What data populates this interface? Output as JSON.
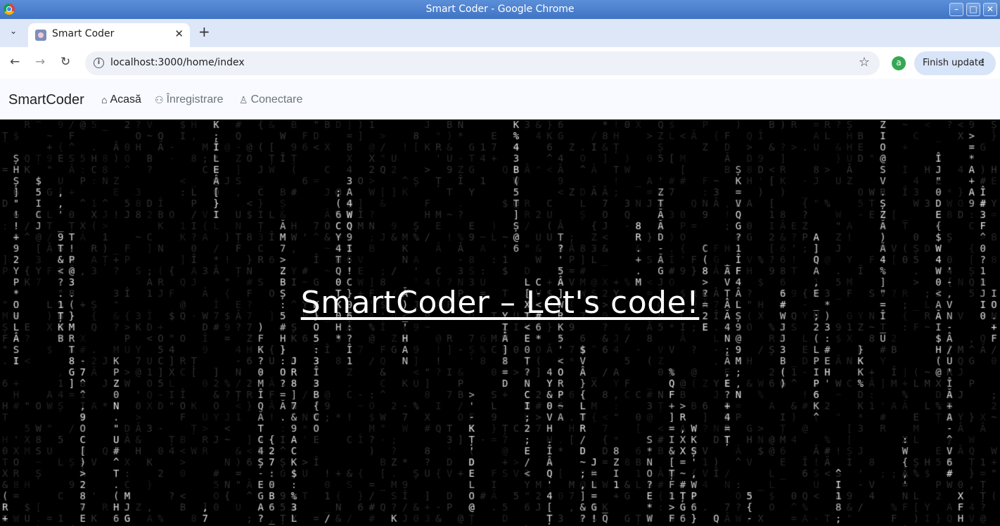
{
  "window": {
    "title": "Smart Coder - Google Chrome",
    "controls": {
      "minimize": "–",
      "maximize": "□",
      "close": "✕"
    }
  },
  "browser": {
    "tab_list_icon": "⌄",
    "tab": {
      "title": "Smart Coder",
      "close": "✕"
    },
    "new_tab": "+",
    "back": "←",
    "forward": "→",
    "reload": "↻",
    "site_info": "i",
    "url": "localhost:3000/home/index",
    "bookmark": "☆",
    "profile_initial": "a",
    "update_button": "Finish update",
    "menu": "⋮"
  },
  "site": {
    "brand": "SmartCoder",
    "nav": [
      {
        "label": "Acasă",
        "icon": "home-icon",
        "glyph": "⌂"
      },
      {
        "label": "Înregistrare",
        "icon": "person-plus-icon",
        "glyph": "⚇"
      },
      {
        "label": "Conectare",
        "icon": "person-icon",
        "glyph": "♙"
      }
    ],
    "hero_title": "SmartCoder – Let's code!"
  },
  "matrix_rain": {
    "charset": "0123456789ABCDEFGHIJKLMNOPQRSTUVWXYZ!@#$%^&*()_+-=[]{};:'\",.<>/?~ÂÎĂȘȚ",
    "bright_color": "#ffffff",
    "dim_color": "#3a3a3a"
  }
}
